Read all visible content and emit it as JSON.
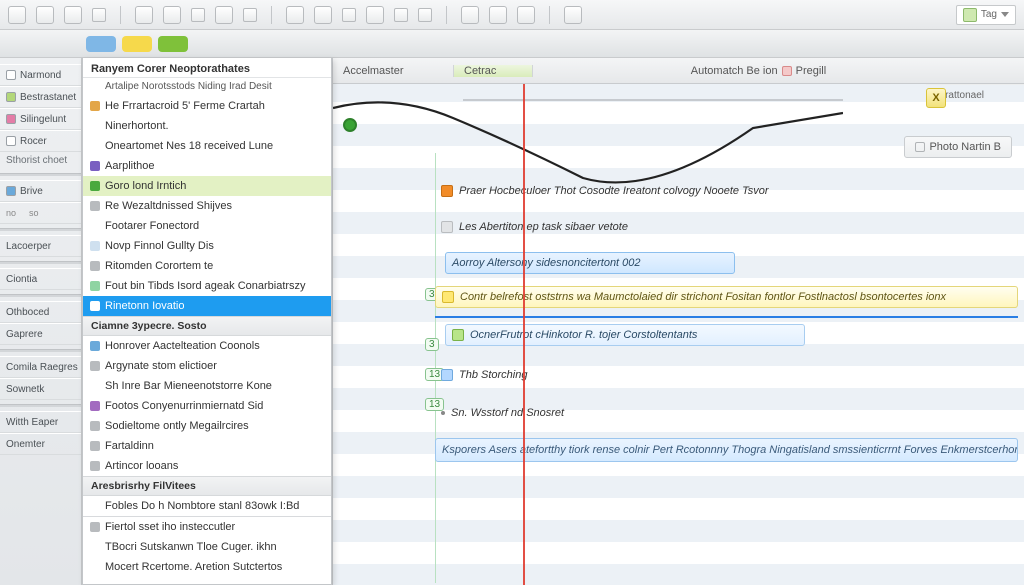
{
  "toolbar_right": {
    "label": "Tag"
  },
  "header": {
    "tabs": [
      "Accelmaster",
      "Cetrac"
    ],
    "center_label": "Automatch Be ion",
    "center_chip": "Pregill",
    "right_tab": "Strattonael",
    "corner_tab": "Photo Nartin B"
  },
  "sidebar": {
    "top": "Narmond",
    "items": [
      "Bestrastanet",
      "Silingelunt",
      "Rocer",
      "Sthorist choet",
      "Brive",
      "Lacoerper",
      "Ciontia",
      "Othboced",
      "Gaprere",
      "Comila Raegres",
      "Sownetk",
      "Witth Eaper",
      "Onemter"
    ],
    "smallA": "no",
    "smallB": "so"
  },
  "menu": {
    "title": "Ranyem Corer Neoptorathates",
    "subtitle": "Artalipe Norotsstods Niding Irad Desit",
    "g1": [
      "He Frrartacroid 5' Ferme Crartah",
      "Ninerhortont.",
      "Oneartomet Nes 18 received Lune",
      "Aarplithoe"
    ],
    "hi_green": "Goro lond Irntich",
    "g2": [
      "Re Wezaltdnissed Shijves",
      "Footarer Fonectord",
      "Novp Finnol Gullty Dis",
      "Ritomden Corortem te",
      "Fout bin Tibds Isord ageak Conarbiatrszy"
    ],
    "hi_blue": "Rinetonn Iovatio",
    "g3_head": "Ciamne 3ypecre. Sosto",
    "g3": [
      "Honrover Aactelteation Coonols",
      "Argynate stom elictioer",
      "Sh Inre Bar Mieneenotstorre Kone",
      "Footos Conyenurrinmiernatd Sid",
      "Sodieltome ontly Megailrcires",
      "Fartaldinn",
      "Artincor looans"
    ],
    "g4_head": "Aresbrisrhy FilVitees",
    "g4": [
      "Fobles Do h Nombtore stanl 83owk I:Bd"
    ],
    "g5": [
      "Fiertol sset iho insteccutler",
      "TBocri Sutskanwn Tloe Cuger. ikhn",
      "Mocert Rcertome. Aretion Sutctertos"
    ]
  },
  "timeline": {
    "rows": [
      {
        "icon": "or",
        "text": "Praer Hocbeculoer Thot Cosodte Ireatont colvogy Nooete Tsvor"
      },
      {
        "icon": "gr",
        "text": "Les Abertiton ep task sibaer vetote"
      },
      {
        "sel": "sel1",
        "text": "Aorroy Altersony sidesnoncitertont 002"
      },
      {
        "icon": "yl",
        "sel": "selY",
        "text": "Contr belrefost oststrns wa Maumctolaied dir strichont Fositan fontlor Fostlnactosl bsontocertes ionx"
      },
      {
        "icon": "ge",
        "sel": "sel1",
        "text": "OcnerFrutrot cHinkotor R. tojer Corstoltentants"
      },
      {
        "icon": "bl",
        "text": "Thb Storching"
      },
      {
        "text": "Sn. Wsstorf nd Snosret"
      },
      {
        "wide": true,
        "text": "Ksporers Asers atefortthy tiork rense colnir Pert Rcotonnny Thogra Ningatisland smssienticrrnt Forves Enkmerstcerhorg Fatutho"
      }
    ],
    "scale_badges": [
      "3",
      "3",
      "13",
      "13"
    ]
  },
  "marker_x": "X"
}
